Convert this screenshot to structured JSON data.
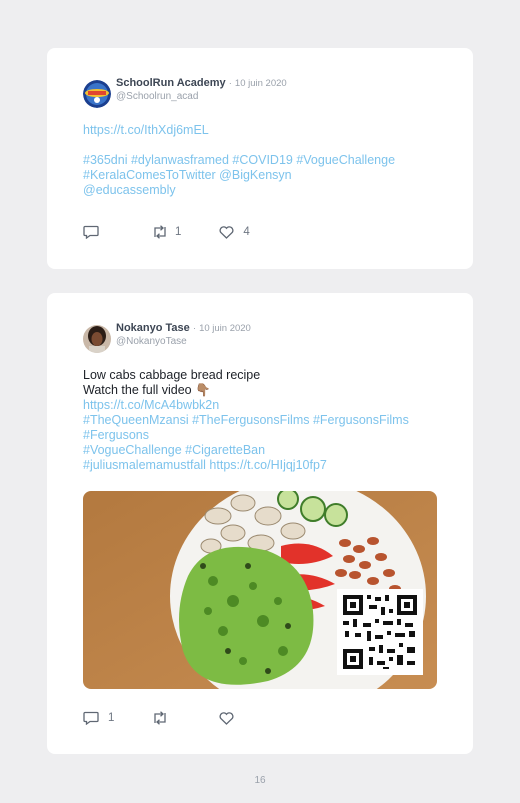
{
  "posts": [
    {
      "author": "SchoolRun Academy",
      "separator": "·",
      "date": "10 juin 2020",
      "handle": "@Schoolrun_acad",
      "link1": "https://t.co/IthXdj6mEL",
      "tags_line1": "#365dni #dylanwasframed #COVID19 #VogueChallenge",
      "tags_line2": "#KeralaComesToTwitter @BigKensyn",
      "tags_line3": "@educassembly",
      "retweets": "1",
      "likes": "4",
      "icons": [
        "avatar-logo",
        "reply-icon",
        "retweet-icon",
        "heart-icon"
      ]
    },
    {
      "author": "Nokanyo Tase",
      "separator": "·",
      "date": "10 juin 2020",
      "handle": "@NokanyoTase",
      "line1": "Low cabs cabbage bread recipe",
      "line2": "Watch the full video 👇🏽",
      "link1": "https://t.co/McA4bwbk2n",
      "tags_line1": "#TheQueenMzansi #TheFergusonsFilms #FergusonsFilms",
      "tags_line2": "#Fergusons",
      "tags_line3": "#VogueChallenge #CigaretteBan",
      "tags_line4": "#juliusmalemamustfall https://t.co/HIjqj10fp7",
      "replies": "1",
      "icons": [
        "avatar-photo",
        "food-photo",
        "qr-code",
        "reply-icon",
        "retweet-icon",
        "heart-icon"
      ]
    }
  ],
  "page_number": "16",
  "colors": {
    "background": "#eeeef0",
    "card": "#ffffff",
    "link": "#7dc3ec",
    "text": "#1d2128",
    "muted": "#9aa1ab"
  }
}
